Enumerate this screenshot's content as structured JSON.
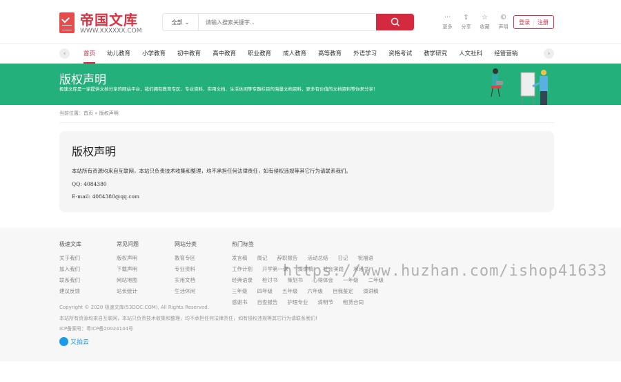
{
  "header": {
    "logo_title": "帝国文库",
    "logo_url": "WWW.XXXXXX.COM",
    "search_category": "全部",
    "search_placeholder": "请输入搜索关键字...",
    "tools": [
      {
        "icon": "more-icon",
        "glyph": "···",
        "label": "更多"
      },
      {
        "icon": "share-icon",
        "glyph": "⇪",
        "label": "分享"
      },
      {
        "icon": "star-icon",
        "glyph": "☆",
        "label": "收藏"
      },
      {
        "icon": "copyright-icon",
        "glyph": "©",
        "label": "声明"
      }
    ],
    "login": "登录",
    "register": "注册"
  },
  "nav": {
    "items": [
      "首页",
      "幼儿教育",
      "小学教育",
      "初中教育",
      "高中教育",
      "职业教育",
      "成人教育",
      "高等教育",
      "外语学习",
      "资格考试",
      "教学研究",
      "人文社科",
      "经管营销"
    ]
  },
  "banner": {
    "title": "版权声明",
    "description": "极速文库是一家提供文档分享的网站平台，我们拥有教育专区、专业资料、实用文档、生活休闲等专题栏目的海量文档资料，更多有价值的文档资料等你来分享！"
  },
  "breadcrumb": {
    "label": "当前位置：",
    "home": "首页",
    "sep": "»",
    "current": "版权声明"
  },
  "content": {
    "title": "版权声明",
    "body": "本站所有资源均来自互联网，本站只负责技术收集和整理，均不承担任何法律责任，如有侵权违规等其它行为请联系我们。",
    "qq": "QQ: 4084380",
    "email": "E-mail: 4084380@qq.com"
  },
  "footer": {
    "cols": [
      {
        "title": "极速文库",
        "links": [
          "关于我们",
          "加入我们",
          "联系我们",
          "建议反馈"
        ]
      },
      {
        "title": "常见问题",
        "links": [
          "版权声明",
          "下载声明",
          "网站地图",
          "站长统计"
        ]
      },
      {
        "title": "网站分类",
        "links": [
          "教育专区",
          "专业资料",
          "实用文档",
          "生活休闲"
        ]
      }
    ],
    "tags_title": "热门标签",
    "tags": [
      "发言稿",
      "周记",
      "辞职报告",
      "活动总结",
      "日记",
      "祝福语",
      "工作计划",
      "开学第一课",
      "演讲稿",
      "社会实践",
      "承诺书",
      "经典语录",
      "检讨书",
      "策划书",
      "心得体会",
      "一年级",
      "二年级",
      "三年级",
      "四年级",
      "五年级",
      "六年级",
      "自我鉴定",
      "演讲稿",
      "感谢书",
      "自查报告",
      "护理专业",
      "清明节",
      "租赁合同"
    ],
    "copyright": "Copyright © 2020 极速文库(53DOC.COM), All Rights Reserved.",
    "disclaimer": "本站所有资源均来自互联网，本站只负责技术收集和整理，均不承担任何法律责任，如有侵权违规等其它行为请联系我们!",
    "icp": "ICP备案号：粤ICP备20024144号",
    "cdn": "又拍云"
  },
  "watermark": "https://www.huzhan.com/ishop41633"
}
